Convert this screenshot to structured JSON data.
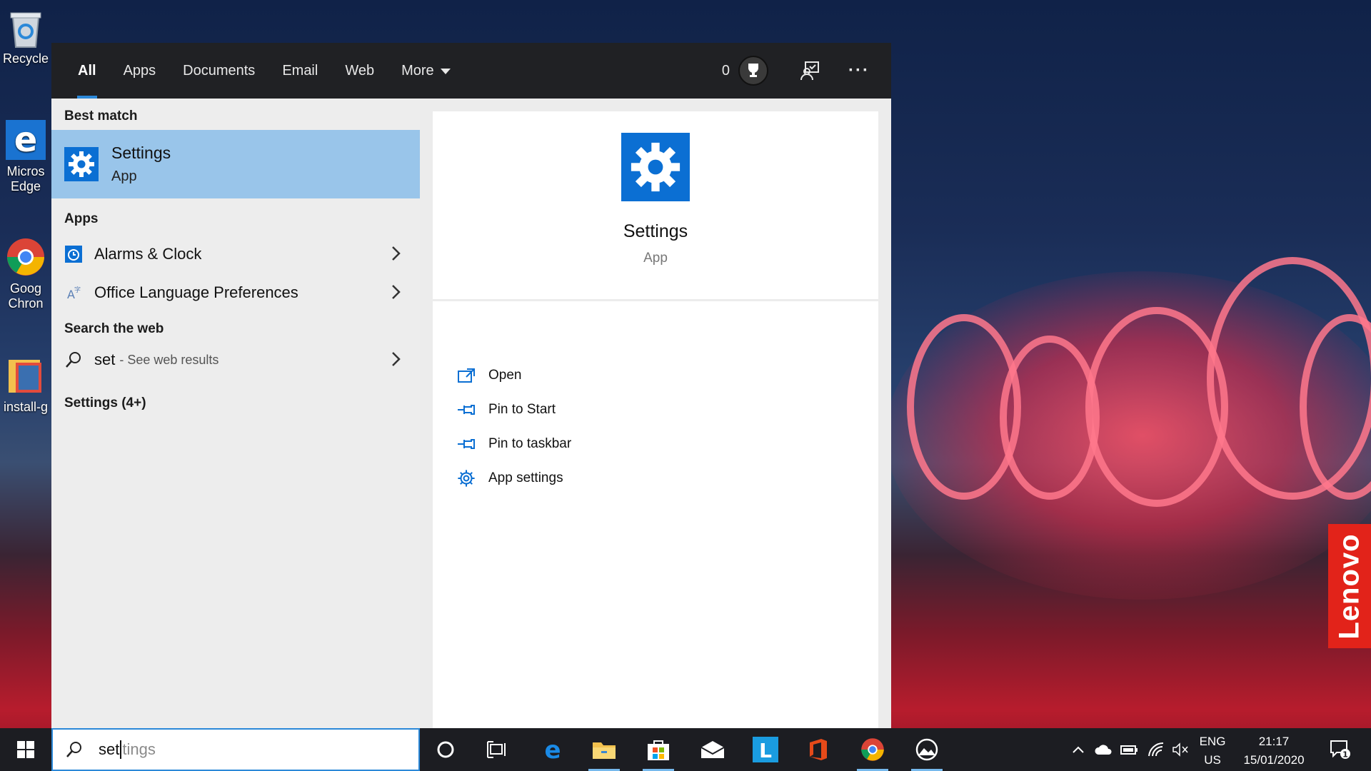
{
  "desktop": {
    "icons": [
      {
        "label": "Recycle",
        "name": "recycle-bin"
      },
      {
        "label": "Micros Edge",
        "name": "microsoft-edge"
      },
      {
        "label": "Goog Chron",
        "name": "google-chrome"
      },
      {
        "label": "install-g",
        "name": "install-guide"
      }
    ],
    "brand": "Lenovo"
  },
  "search_panel": {
    "tabs": [
      {
        "label": "All",
        "active": true
      },
      {
        "label": "Apps"
      },
      {
        "label": "Documents"
      },
      {
        "label": "Email"
      },
      {
        "label": "Web"
      },
      {
        "label": "More"
      }
    ],
    "points": "0",
    "sections": {
      "best_match": "Best match",
      "apps": "Apps",
      "search_web": "Search the web",
      "settings_more": "Settings (4+)"
    },
    "best_match": {
      "title": "Settings",
      "subtitle": "App"
    },
    "apps": [
      {
        "label": "Alarms & Clock",
        "icon": "alarm-clock-icon"
      },
      {
        "label": "Office Language Preferences",
        "icon": "language-icon"
      }
    ],
    "web": {
      "query": "set",
      "hint": "- See web results"
    },
    "preview": {
      "title": "Settings",
      "subtitle": "App",
      "actions": [
        {
          "label": "Open",
          "icon": "open-icon"
        },
        {
          "label": "Pin to Start",
          "icon": "pin-icon"
        },
        {
          "label": "Pin to taskbar",
          "icon": "pin-icon"
        },
        {
          "label": "App settings",
          "icon": "gear-icon"
        }
      ]
    }
  },
  "taskbar": {
    "search_typed": "set",
    "search_suggest": "tings",
    "lang": "ENG",
    "region": "US",
    "time": "21:17",
    "date": "15/01/2020",
    "notifications": "1"
  },
  "colors": {
    "accent": "#0b6fd3",
    "selection": "#99c5ea",
    "topbar": "#202124"
  }
}
